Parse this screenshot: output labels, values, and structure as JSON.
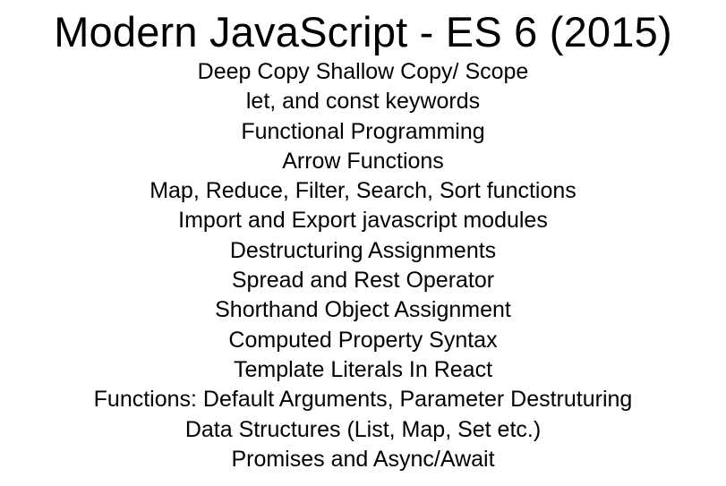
{
  "slide": {
    "title": "Modern JavaScript  - ES 6 (2015)",
    "topics": [
      "Deep Copy Shallow Copy/ Scope",
      "let, and const keywords",
      "Functional Programming",
      "Arrow Functions",
      "Map, Reduce, Filter, Search, Sort functions",
      "Import and Export javascript modules",
      "Destructuring Assignments",
      "Spread and Rest Operator",
      "Shorthand Object Assignment",
      "Computed Property Syntax",
      "Template Literals In React",
      "Functions: Default Arguments, Parameter Destruturing",
      "Data Structures (List, Map, Set etc.)",
      "Promises and Async/Await"
    ]
  }
}
